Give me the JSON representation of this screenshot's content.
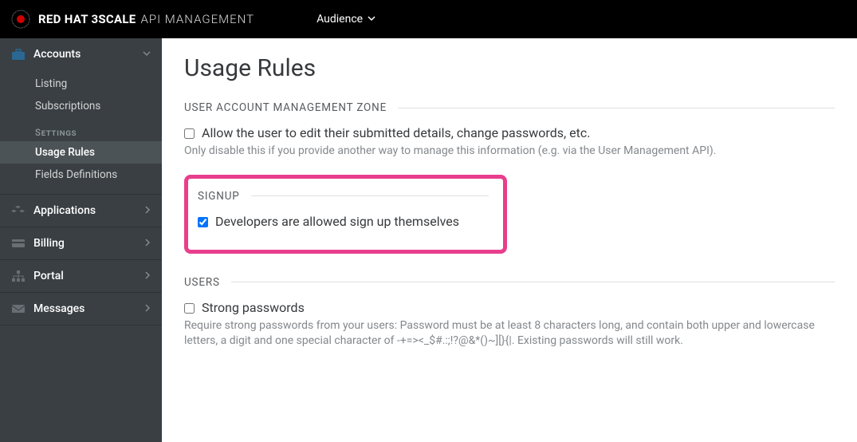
{
  "topbar": {
    "brand_bold": "RED HAT 3SCALE",
    "brand_thin": "API MANAGEMENT",
    "audience_label": "Audience"
  },
  "sidebar": {
    "groups": [
      {
        "label": "Accounts",
        "expanded": true,
        "items": [
          {
            "label": "Listing"
          },
          {
            "label": "Subscriptions"
          }
        ],
        "subgroup_label": "Settings",
        "subgroup_items": [
          {
            "label": "Usage Rules",
            "active": true
          },
          {
            "label": "Fields Definitions"
          }
        ]
      },
      {
        "label": "Applications"
      },
      {
        "label": "Billing"
      },
      {
        "label": "Portal"
      },
      {
        "label": "Messages"
      }
    ]
  },
  "page": {
    "title": "Usage Rules",
    "sections": {
      "uamz": {
        "heading": "USER ACCOUNT MANAGEMENT ZONE",
        "option1_label": "Allow the user to edit their submitted details, change passwords, etc.",
        "option1_help": "Only disable this if you provide another way to manage this information (e.g. via the User Management API).",
        "option1_checked": false
      },
      "signup": {
        "heading": "SIGNUP",
        "option1_label": "Developers are allowed sign up themselves",
        "option1_checked": true
      },
      "users": {
        "heading": "USERS",
        "option1_label": "Strong passwords",
        "option1_help": "Require strong passwords from your users: Password must be at least 8 characters long, and contain both upper and lowercase letters, a digit and one special character of -+=><_$#.:;!?@&*()~][}{|. Existing passwords will still work.",
        "option1_checked": false
      }
    }
  }
}
